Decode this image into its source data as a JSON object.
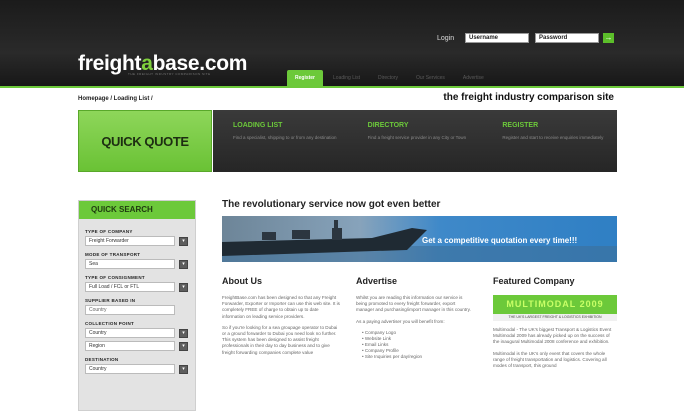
{
  "header": {
    "logo_prefix": "freight",
    "logo_accent": "a",
    "logo_suffix": "base.com",
    "logo_tagline": "THE FREIGHT INDUSTRY COMPARISON SITE",
    "login_label": "Login",
    "username_value": "Username",
    "password_value": "Password",
    "go_symbol": "→",
    "nav": [
      "Register",
      "Loading List",
      "Directory",
      "Our Services",
      "Advertise"
    ]
  },
  "breadcrumb": "Homepage / Loading List /",
  "slogan": "the freight industry comparison site",
  "quick_quote": "QUICK QUOTE",
  "promo": [
    {
      "title": "LOADING LIST",
      "text": "Find a specialist, shipping to or from any destination"
    },
    {
      "title": "DIRECTORY",
      "text": "Find a freight service provider in any City or Town"
    },
    {
      "title": "REGISTER",
      "text": "Register and start to receive enquiries immediately"
    }
  ],
  "sidebar": {
    "title": "QUICK SEARCH",
    "type_company_label": "TYPE OF COMPANY",
    "type_company_value": "Freight Forwarder",
    "mode_label": "MODE OF TRANSPORT",
    "mode_value": "Sea",
    "consignment_label": "TYPE OF CONSIGNMENT",
    "consignment_value": "Full Load / FCL or FTL",
    "based_label": "SUPPLIER BASED IN",
    "based_value": "Country",
    "collection_label": "COLLECTION POINT",
    "collection_country": "Country",
    "collection_region": "Region",
    "destination_label": "DESTINATION",
    "destination_country": "Country",
    "arrow": "▾"
  },
  "main": {
    "headline": "The revolutionary service now got even better",
    "banner_text": "Get a competitive quotation every time!!!",
    "about": {
      "title": "About Us",
      "p1": "FreightBase.com has been designed so that any Freight Forwarder, Exporter or Importer can use this web site. It is completely FREE of charge to obtain up to date information on leading service providers.",
      "p2": "So if you're looking for a sea groupage operator to Dubai or a ground forwarder to Dubai you need look no further. This system has been designed to assist freight professionals in their day to day business and to give freight forwarding companies complete value"
    },
    "advertise": {
      "title": "Advertise",
      "p1": "Whilst you are reading this information our service is being promoted to every freight forwarder, export manager and purchasing/import manager in this country.",
      "p2": "As a paying advertiser you will benefit from:",
      "items": [
        "Company Logo",
        "Website Link",
        "Email Links",
        "Company Profile",
        "Site Inquiries per day/region"
      ]
    },
    "featured": {
      "title": "Featured Company",
      "logo_text": "MULTIMODAL 2009",
      "logo_sub": "THE UK'S LARGEST FREIGHT & LOGISTICS EXHIBITION",
      "p1": "Multimodal - The UK's biggest Transport & Logistics Event Multimodal 2009 has already picked up on the success of the inaugural Multimodal 2008 conference and exhibition.",
      "p2": "Multimodal is the UK's only event that covers the whole range of freight transportation and logistics. Covering all modes of transport, this ground"
    }
  }
}
